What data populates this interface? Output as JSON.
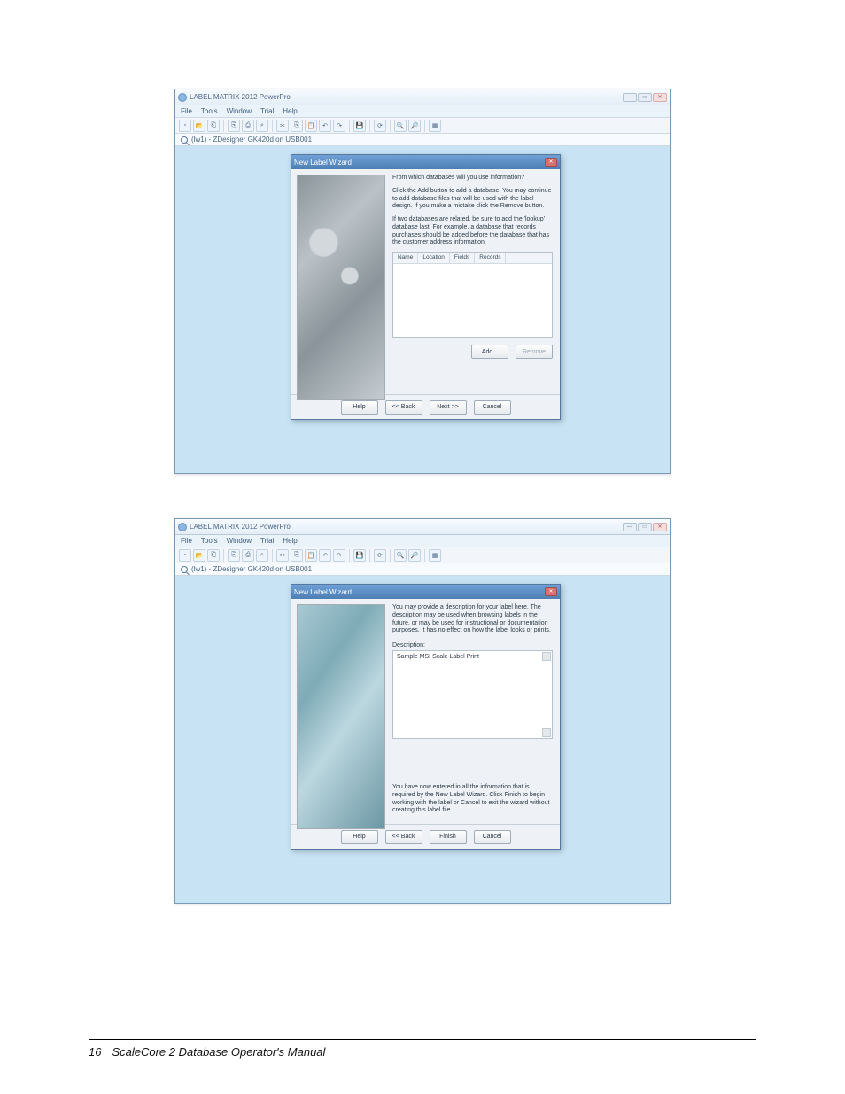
{
  "footer": {
    "page": "16",
    "doc": "ScaleCore 2 Database Operator's Manual"
  },
  "app": {
    "title": "LABEL MATRIX 2012 PowerPro",
    "menu": [
      "File",
      "Tools",
      "Window",
      "Trial",
      "Help"
    ],
    "info": "(lw1) - ZDesigner GK420d on USB001",
    "winbtns": {
      "min": "—",
      "max": "▭",
      "close": "✕"
    }
  },
  "toolbar_icons": [
    "new",
    "open",
    "close",
    "newdoc",
    "print",
    "preview",
    "cut",
    "copy",
    "paste",
    "undo",
    "redo",
    "save",
    "refresh",
    "zoomout",
    "zoomin",
    "grid"
  ],
  "wizard": {
    "title": "New Label Wizard",
    "close": "✕"
  },
  "s1": {
    "q": "From which databases will you use information?",
    "p1": "Click the Add button to add a database. You may continue to add database files that will be used with the label design. If you make a mistake click the Remove button.",
    "p2": "If two databases are related, be sure to add the 'lookup' database last. For example, a database that records purchases should be added before the database that has the customer address information.",
    "cols": {
      "c1": "Name",
      "c2": "Location",
      "c3": "Fields",
      "c4": "Records"
    },
    "add": "Add...",
    "remove": "Remove",
    "help": "Help",
    "back": "<< Back",
    "next": "Next >>",
    "cancel": "Cancel"
  },
  "s2": {
    "p1": "You may provide a description for your label here. The description may be used when browsing labels in the future, or may be used for instructional or documentation purposes. It has no effect on how the label looks or prints.",
    "label": "Description:",
    "value": "Sample MSI Scale Label Print",
    "p2": "You have now entered in all the information that is required by the New Label Wizard. Click Finish to begin working with the label or Cancel to exit the wizard without creating this label file.",
    "help": "Help",
    "back": "<< Back",
    "finish": "Finish",
    "cancel": "Cancel"
  }
}
